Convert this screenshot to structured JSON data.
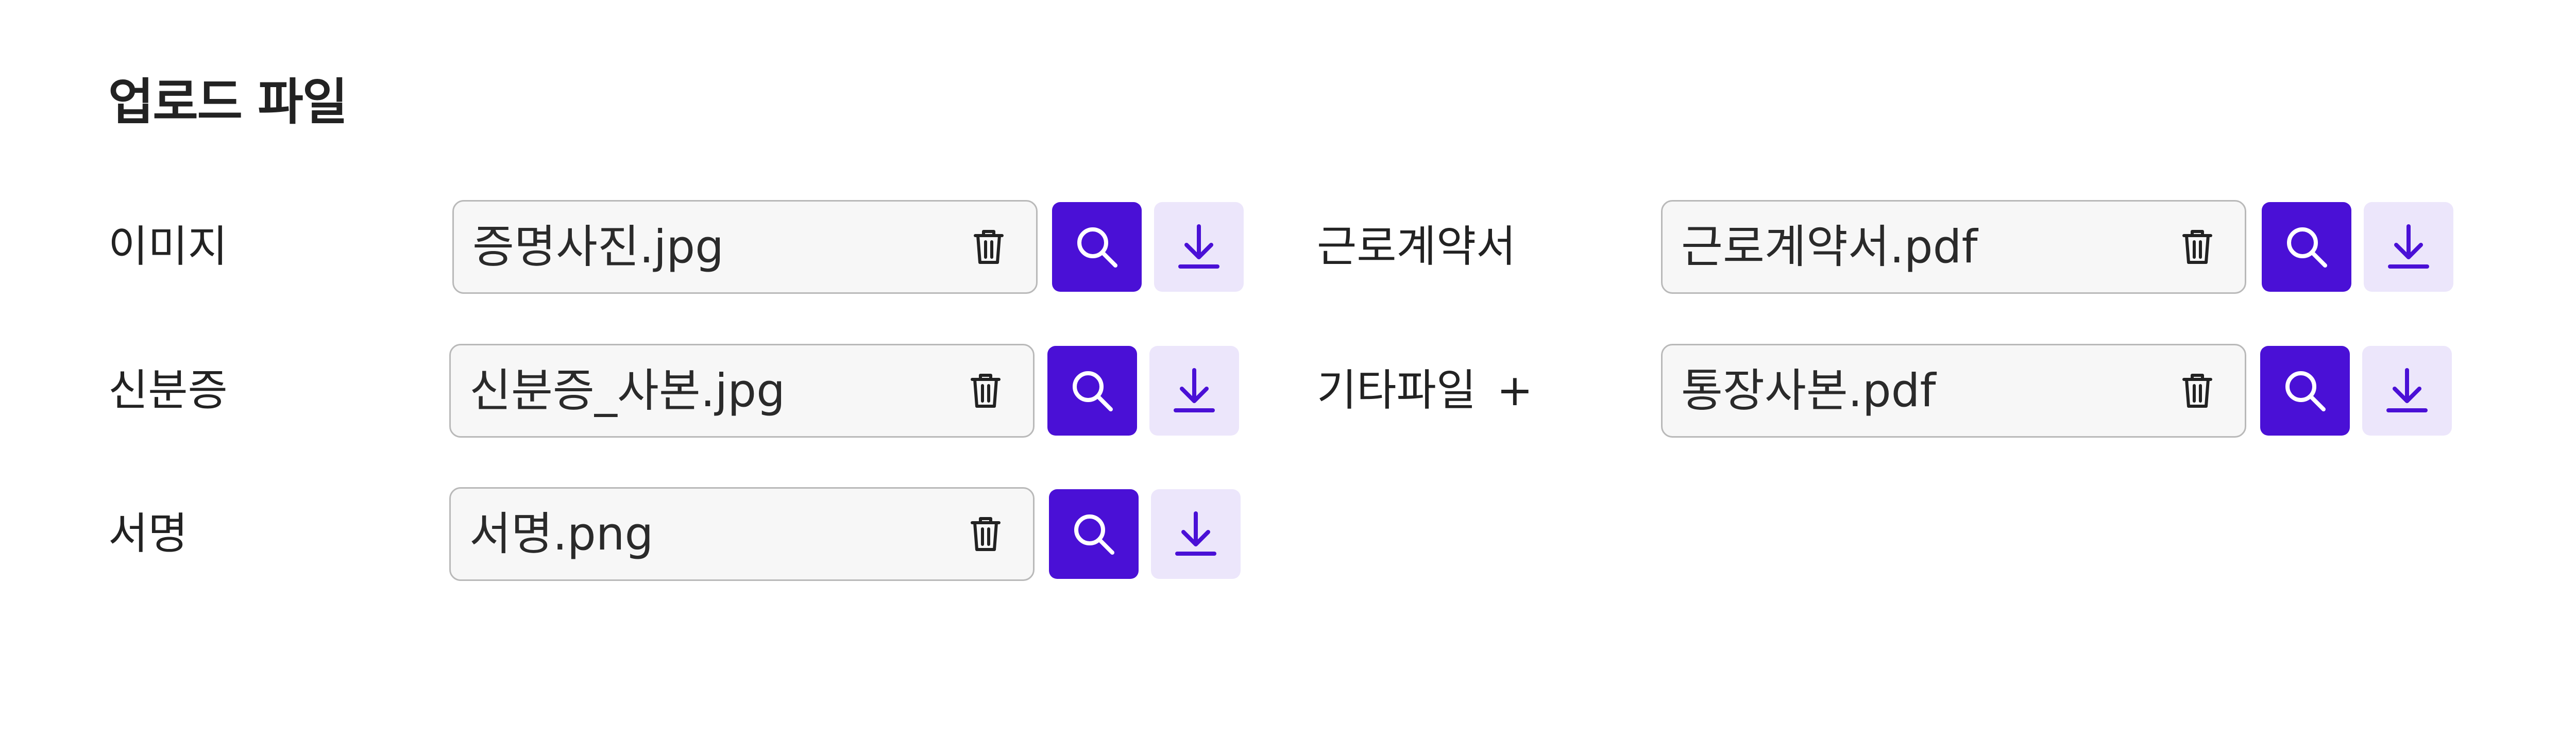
{
  "title": "업로드 파일",
  "colors": {
    "accent": "#4a10d6",
    "accent_light": "#ece6fb",
    "field_border": "#b9b9b9",
    "field_bg": "#f7f7f7"
  },
  "fields": [
    {
      "label": "이미지",
      "value": "증명사진.jpg",
      "trash_icon": "trash-icon",
      "search_icon": "search-icon",
      "download_icon": "download-icon"
    },
    {
      "label": "신분증",
      "value": "신분증_사본.jpg",
      "trash_icon": "trash-icon",
      "search_icon": "search-icon",
      "download_icon": "download-icon"
    },
    {
      "label": "서명",
      "value": "서명.png",
      "trash_icon": "trash-icon",
      "search_icon": "search-icon",
      "download_icon": "download-icon"
    },
    {
      "label": "근로계약서",
      "value": "근로계약서.pdf",
      "trash_icon": "trash-icon",
      "search_icon": "search-icon",
      "download_icon": "download-icon"
    },
    {
      "label": "기타파일",
      "add_label": "+",
      "value": "통장사본.pdf",
      "trash_icon": "trash-icon",
      "search_icon": "search-icon",
      "download_icon": "download-icon"
    }
  ]
}
